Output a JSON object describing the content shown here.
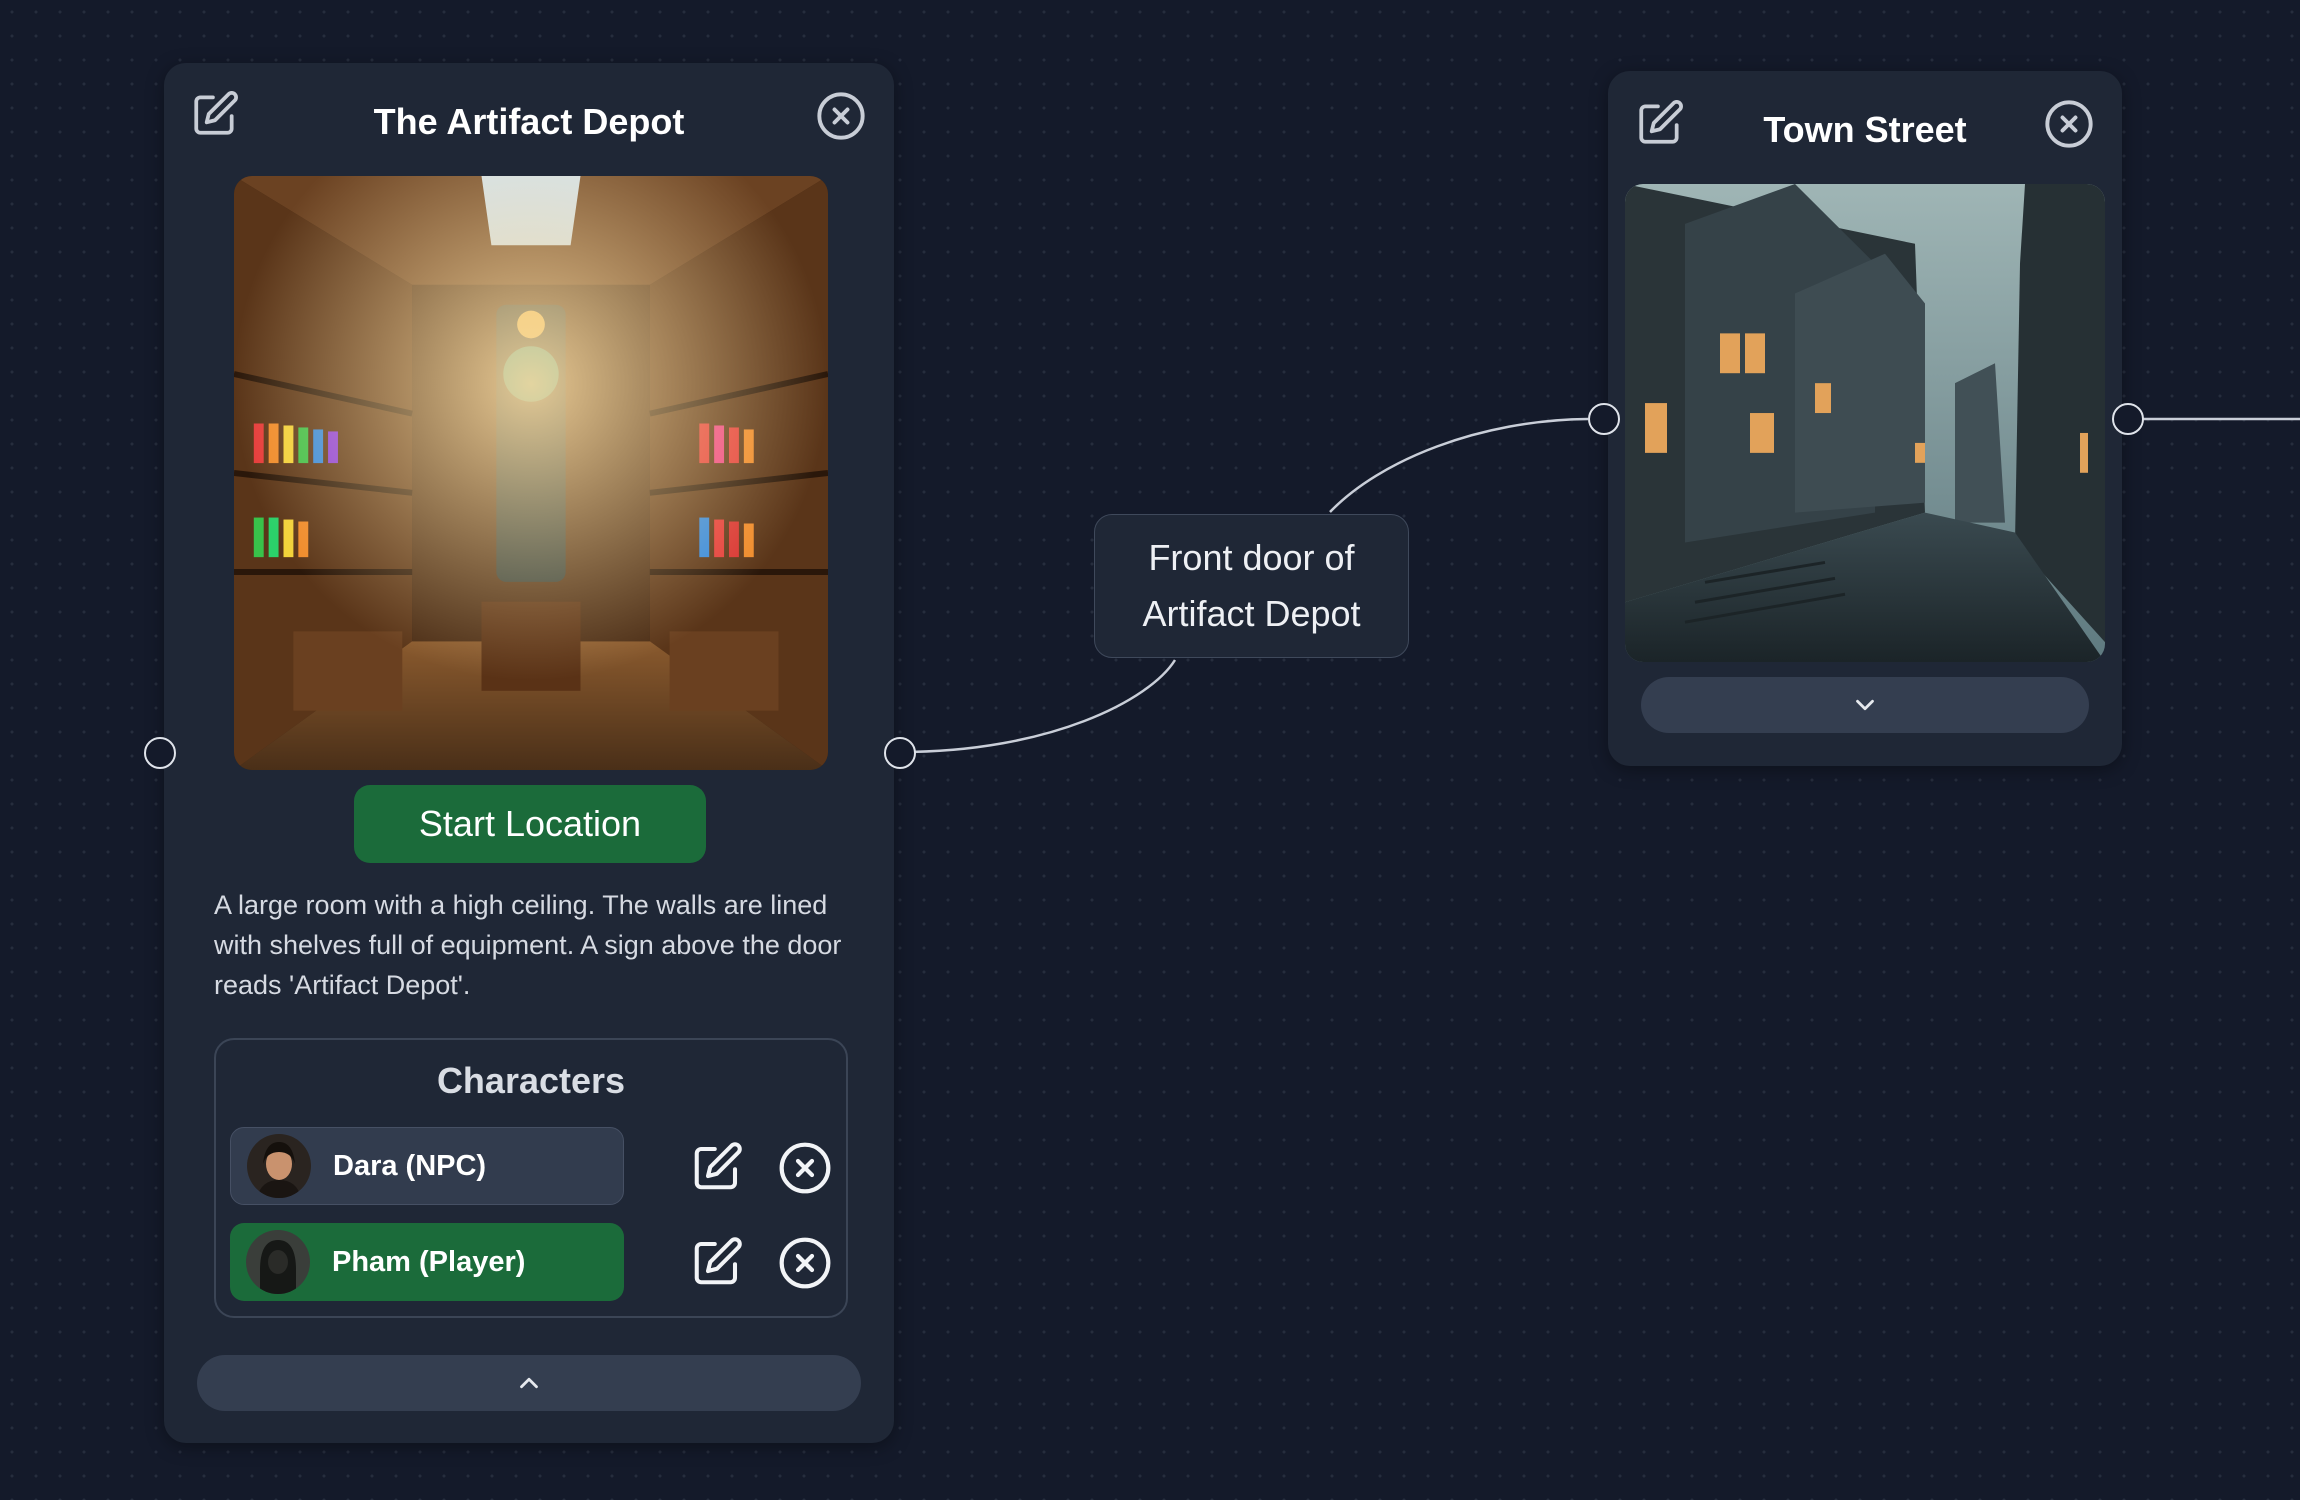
{
  "nodes": {
    "artifact_depot": {
      "title": "The Artifact Depot",
      "image_subject": "interior of an artifact shop with shelves of equipment and colorful potions",
      "start_label": "Start Location",
      "description": "A large room with a high ceiling. The walls are lined with shelves full of equipment. A sign above the door reads 'Artifact Depot'.",
      "characters_title": "Characters",
      "characters": [
        {
          "name": "Dara (NPC)",
          "role": "npc"
        },
        {
          "name": "Pham (Player)",
          "role": "player"
        }
      ],
      "toggle_icon": "chevron-up-icon"
    },
    "town_street": {
      "title": "Town Street",
      "image_subject": "dark cobblestone street lined with old wooden houses at dusk",
      "toggle_icon": "chevron-down-icon"
    }
  },
  "edges": [
    {
      "label": "Front door of Artifact Depot"
    }
  ],
  "colors": {
    "canvas_bg": "#141a2a",
    "card_bg": "#1f2736",
    "accent_green": "#1b6b3a",
    "handle_border": "#dfe3ea",
    "edge_stroke": "#c9ced8"
  }
}
